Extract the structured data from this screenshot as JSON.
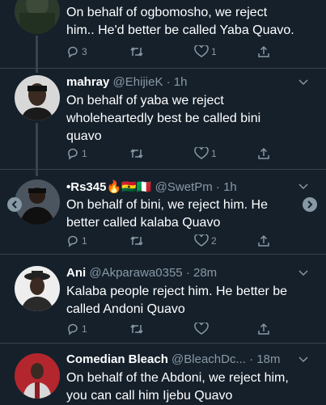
{
  "tweets": [
    {
      "name": "",
      "handle": "",
      "time": "",
      "text_lines": [
        "On behalf of ogbomosho,  we reject",
        "him..  He'd better be called Yaba Quavo."
      ],
      "reply_count": "3",
      "retweet_count": "",
      "like_count": "1"
    },
    {
      "name": "mahray",
      "handle": "@EhijieK",
      "time": "· 1h",
      "text_lines": [
        "On behalf of yaba we reject",
        "wholeheartedly best be called bini",
        "quavo"
      ],
      "reply_count": "1",
      "retweet_count": "",
      "like_count": "1"
    },
    {
      "name": "•Rs345🔥🇬🇭🇮🇹",
      "handle": "@SwetPm",
      "time": "· 1h",
      "text_lines": [
        "On behalf of bini, we reject him. He",
        "better called kalaba Quavo"
      ],
      "reply_count": "1",
      "retweet_count": "",
      "like_count": "2"
    },
    {
      "name": "Ani",
      "handle": "@Akparawa0355",
      "time": "· 28m",
      "text_lines": [
        "Kalaba people reject him. He better be",
        "called Andoni Quavo"
      ],
      "reply_count": "1",
      "retweet_count": "",
      "like_count": ""
    },
    {
      "name": "Comedian Bleach",
      "handle": "@BleachDc...",
      "time": "· 18m",
      "text_lines": [
        "On behalf of the Abdoni, we reject him,",
        "you can call him Ijebu Quavo"
      ]
    }
  ],
  "colors": {
    "background": "#15202b",
    "secondary_text": "#8899a6",
    "divider": "#38444d"
  },
  "icons": [
    "reply-icon",
    "retweet-icon",
    "like-icon",
    "share-icon",
    "chevron-down-icon",
    "carousel-prev-icon",
    "carousel-next-icon"
  ]
}
